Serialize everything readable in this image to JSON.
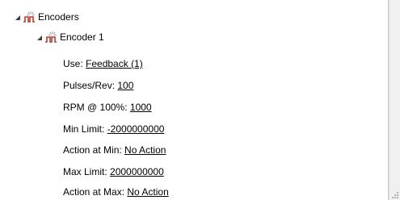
{
  "tree": {
    "root": {
      "label": "Encoders",
      "icon": "encoder-signal-icon",
      "expanded": true
    },
    "child": {
      "label": "Encoder 1",
      "icon": "encoder-signal-icon",
      "expanded": true
    },
    "properties": [
      {
        "key": "use",
        "label": "Use:",
        "value": "Feedback (1)"
      },
      {
        "key": "pulses-rev",
        "label": "Pulses/Rev:",
        "value": "100"
      },
      {
        "key": "rpm-100",
        "label": "RPM @ 100%:",
        "value": "1000"
      },
      {
        "key": "min-limit",
        "label": "Min Limit:",
        "value": "-2000000000"
      },
      {
        "key": "action-at-min",
        "label": "Action at Min:",
        "value": "No Action"
      },
      {
        "key": "max-limit",
        "label": "Max Limit:",
        "value": "2000000000"
      },
      {
        "key": "action-at-max",
        "label": "Action at Max:",
        "value": "No Action"
      }
    ]
  },
  "colors": {
    "icon_spark": "#9a9a9a",
    "icon_pulse": "#c0392b",
    "expander": "#404040"
  }
}
